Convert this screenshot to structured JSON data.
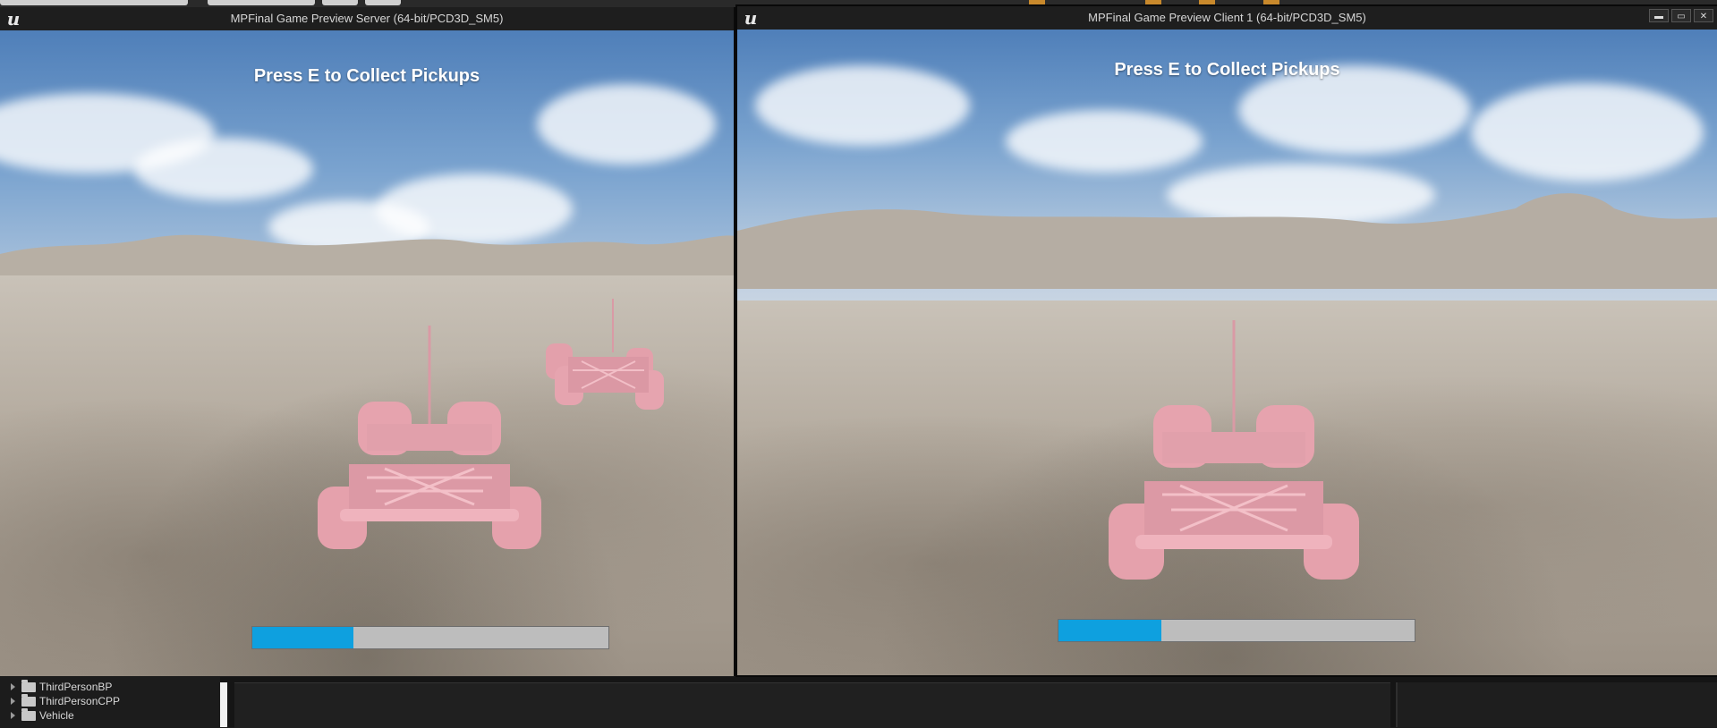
{
  "server_window": {
    "title": "MPFinal Game Preview Server (64-bit/PCD3D_SM5)",
    "hud_message": "Press E to Collect Pickups",
    "progress": 0.285
  },
  "client_window": {
    "title": "MPFinal Game Preview Client 1 (64-bit/PCD3D_SM5)",
    "hud_message": "Press E to Collect Pickups",
    "progress": 0.29,
    "controls": {
      "minimize": "▬",
      "maximize": "▭",
      "close": "✕"
    }
  },
  "icons": {
    "app_logo": "unreal-engine-logo-icon",
    "folder": "folder-icon",
    "expand": "triangle-right-icon"
  },
  "colors": {
    "progress_fill": "#0ea0df",
    "progress_track": "#bdbdbd",
    "vehicle": "#e8a8b4"
  },
  "content_browser": {
    "folders": [
      {
        "label": "ThirdPersonBP"
      },
      {
        "label": "ThirdPersonCPP"
      },
      {
        "label": "Vehicle"
      }
    ]
  }
}
